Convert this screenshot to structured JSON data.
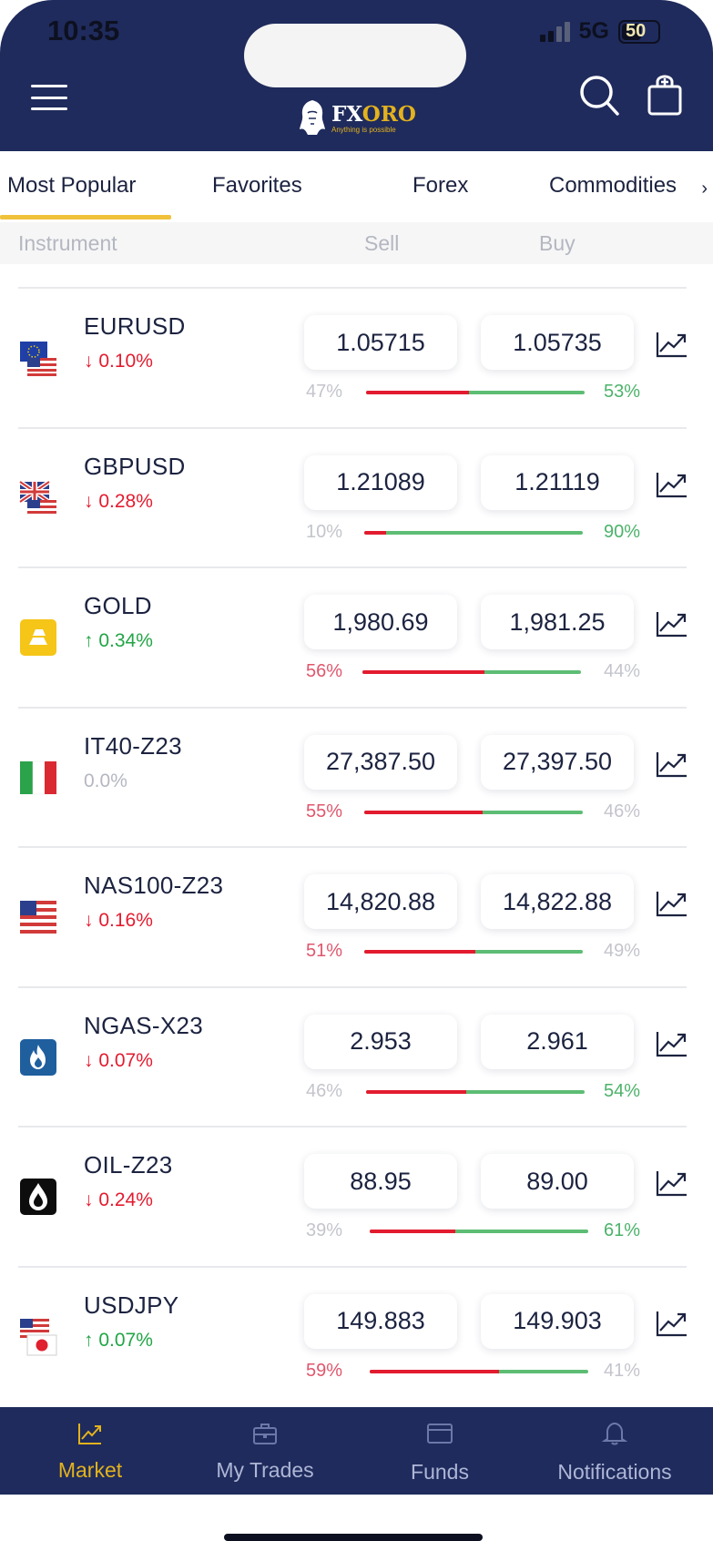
{
  "status_bar": {
    "time": "10:35",
    "network": "5G",
    "battery": "50"
  },
  "header": {
    "brand_fx": "FX",
    "brand_oro": "ORO",
    "tagline": "Anything is possible",
    "icons": {
      "menu": "hamburger-menu-icon",
      "search": "search-icon",
      "bag": "shopping-bag-icon"
    }
  },
  "tabs": [
    {
      "label": "Most Popular",
      "active": true
    },
    {
      "label": "Favorites",
      "active": false
    },
    {
      "label": "Forex",
      "active": false
    },
    {
      "label": "Commodities",
      "active": false
    }
  ],
  "columns": {
    "instrument": "Instrument",
    "sell": "Sell",
    "buy": "Buy"
  },
  "instruments": [
    {
      "symbol": "EURUSD",
      "change": "↓ 0.10%",
      "direction": "down",
      "sell": "1.05715",
      "buy": "1.05735",
      "sell_pct": "47%",
      "buy_pct": "53%",
      "sell_share": 0.47,
      "flag": "eu-us-flag-icon"
    },
    {
      "symbol": "GBPUSD",
      "change": "↓ 0.28%",
      "direction": "down",
      "sell": "1.21089",
      "buy": "1.21119",
      "sell_pct": "10%",
      "buy_pct": "90%",
      "sell_share": 0.1,
      "flag": "uk-us-flag-icon"
    },
    {
      "symbol": "GOLD",
      "change": "↑ 0.34%",
      "direction": "up",
      "sell": "1,980.69",
      "buy": "1,981.25",
      "sell_pct": "56%",
      "buy_pct": "44%",
      "sell_share": 0.56,
      "flag": "gold-bars-icon"
    },
    {
      "symbol": "IT40-Z23",
      "change": "0.0%",
      "direction": "flat",
      "sell": "27,387.50",
      "buy": "27,397.50",
      "sell_pct": "55%",
      "buy_pct": "46%",
      "sell_share": 0.54,
      "flag": "italy-flag-icon"
    },
    {
      "symbol": "NAS100-Z23",
      "change": "↓ 0.16%",
      "direction": "down",
      "sell": "14,820.88",
      "buy": "14,822.88",
      "sell_pct": "51%",
      "buy_pct": "49%",
      "sell_share": 0.51,
      "flag": "us-flag-icon"
    },
    {
      "symbol": "NGAS-X23",
      "change": "↓ 0.07%",
      "direction": "down",
      "sell": "2.953",
      "buy": "2.961",
      "sell_pct": "46%",
      "buy_pct": "54%",
      "sell_share": 0.46,
      "flag": "gas-flame-icon"
    },
    {
      "symbol": "OIL-Z23",
      "change": "↓ 0.24%",
      "direction": "down",
      "sell": "88.95",
      "buy": "89.00",
      "sell_pct": "39%",
      "buy_pct": "61%",
      "sell_share": 0.39,
      "flag": "oil-drop-icon"
    },
    {
      "symbol": "USDJPY",
      "change": "↑ 0.07%",
      "direction": "up",
      "sell": "149.883",
      "buy": "149.903",
      "sell_pct": "59%",
      "buy_pct": "41%",
      "sell_share": 0.59,
      "flag": "us-japan-flag-icon"
    }
  ],
  "bottom_nav": [
    {
      "label": "Market",
      "icon": "market-chart-icon",
      "active": true
    },
    {
      "label": "My Trades",
      "icon": "briefcase-icon",
      "active": false
    },
    {
      "label": "Funds",
      "icon": "credit-card-icon",
      "active": false
    },
    {
      "label": "Notifications",
      "icon": "bell-icon",
      "active": false
    }
  ],
  "colors": {
    "navy": "#1f2b5c",
    "gold": "#e3b21d",
    "red": "#e31b2f",
    "green": "#22a546"
  }
}
